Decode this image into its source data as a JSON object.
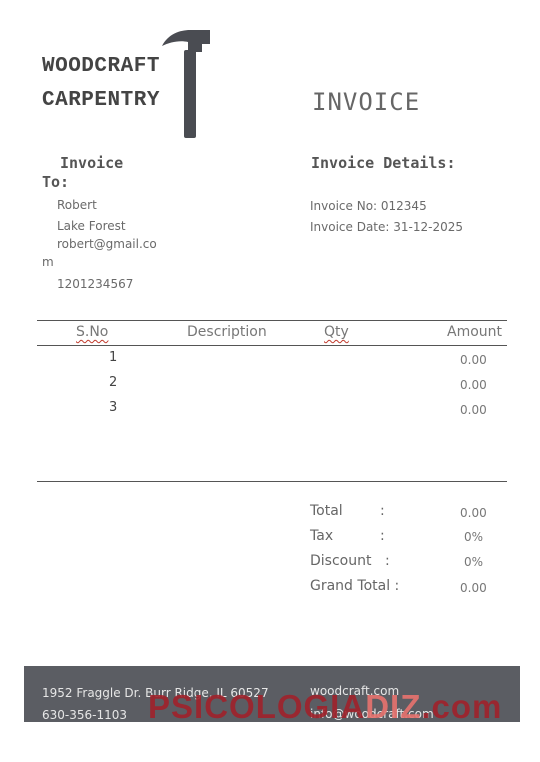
{
  "company": {
    "line1": "WOODCRAFT",
    "line2": "CARPENTRY"
  },
  "title": "INVOICE",
  "invoice_to": {
    "heading_1": "Invoice",
    "heading_2": "To:",
    "name": "Robert",
    "city": "Lake Forest",
    "email_1": "robert@gmail.co",
    "email_2": "m",
    "phone": "1201234567"
  },
  "details": {
    "heading": "Invoice Details:",
    "number": "Invoice No: 012345",
    "date": "Invoice Date: 31-12-2025"
  },
  "table": {
    "headers": {
      "sno": "S.No",
      "description": "Description",
      "qty": "Qty",
      "amount": "Amount"
    },
    "rows": [
      {
        "sno": "1",
        "amount": "0.00"
      },
      {
        "sno": "2",
        "amount": "0.00"
      },
      {
        "sno": "3",
        "amount": "0.00"
      }
    ]
  },
  "totals": [
    {
      "label": "Total",
      "colon": ":",
      "value": "0.00"
    },
    {
      "label": "Tax",
      "colon": ":",
      "value": "0%"
    },
    {
      "label": "Discount",
      "colon": ":",
      "value": "0%"
    },
    {
      "label": "Grand Total :",
      "colon": "",
      "value": "0.00"
    }
  ],
  "footer": {
    "address": "1952 Fraggle Dr. Burr Ridge, IL 60527",
    "phone": "630-356-1103",
    "website": "woodcraft.com",
    "email": "info@woodcraft.com"
  },
  "watermark": {
    "part1": "PSICOLOGIA",
    "part2": "DIZ",
    "part3": ".com"
  },
  "colors": {
    "footer_bg": "#5b5d63",
    "hammer": "#4a4c52",
    "watermark": "#a0222b"
  }
}
